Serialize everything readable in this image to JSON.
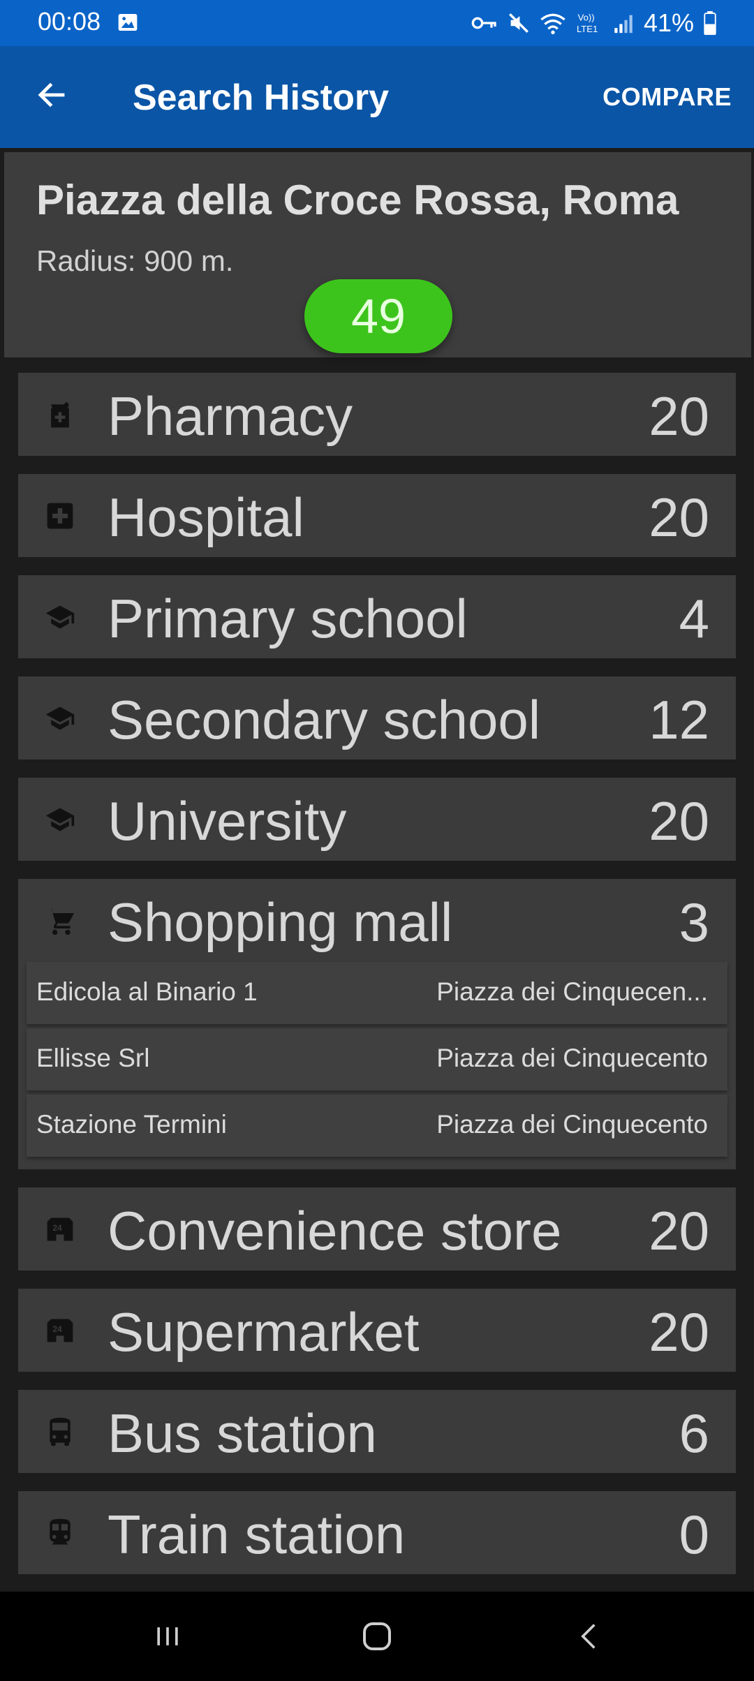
{
  "status_bar": {
    "time": "00:08",
    "battery": "41%",
    "icons": [
      "image-icon",
      "vpn-key-icon",
      "mute-icon",
      "wifi-icon",
      "volte-icon",
      "signal-icon",
      "battery-icon"
    ]
  },
  "app_bar": {
    "title": "Search History",
    "compare_label": "COMPARE",
    "back_icon": "arrow-left-icon"
  },
  "location": {
    "name": "Piazza della Croce Rossa, Roma",
    "radius": "Radius: 900 m.",
    "score": "49",
    "score_color": "#3dc41c"
  },
  "categories": [
    {
      "label": "Pharmacy",
      "count": "20",
      "icon": "pharmacy-icon"
    },
    {
      "label": "Hospital",
      "count": "20",
      "icon": "hospital-icon"
    },
    {
      "label": "Primary school",
      "count": "4",
      "icon": "school-icon"
    },
    {
      "label": "Secondary school",
      "count": "12",
      "icon": "school-icon"
    },
    {
      "label": "University",
      "count": "20",
      "icon": "school-icon"
    },
    {
      "label": "Shopping mall",
      "count": "3",
      "icon": "cart-icon",
      "places": [
        {
          "name": "Edicola al Binario 1",
          "address": "Piazza dei Cinquecen..."
        },
        {
          "name": "Ellisse Srl",
          "address": "Piazza dei Cinquecento"
        },
        {
          "name": "Stazione Termini",
          "address": "Piazza dei Cinquecento"
        }
      ]
    },
    {
      "label": "Convenience store",
      "count": "20",
      "icon": "store-24h-icon"
    },
    {
      "label": "Supermarket",
      "count": "20",
      "icon": "store-24h-icon"
    },
    {
      "label": "Bus station",
      "count": "6",
      "icon": "bus-icon"
    },
    {
      "label": "Train station",
      "count": "0",
      "icon": "train-icon"
    }
  ],
  "nav_bar": {
    "icons": [
      "recent-apps-icon",
      "home-icon",
      "back-icon"
    ]
  }
}
